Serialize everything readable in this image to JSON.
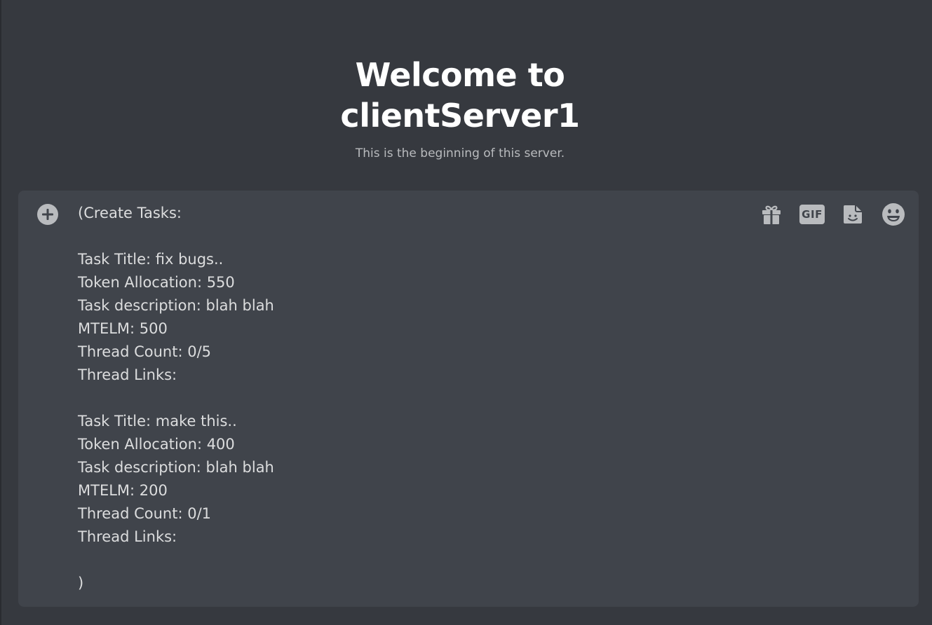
{
  "welcome": {
    "title_line1": "Welcome to",
    "title_line2": "clientServer1",
    "subtitle": "This is the beginning of this server."
  },
  "composer": {
    "message": "(Create Tasks:\n\nTask Title: fix bugs..\nToken Allocation: 550\nTask description: blah blah\nMTELM: 500\nThread Count: 0/5\nThread Links:\n\nTask Title: make this..\nToken Allocation: 400\nTask description: blah blah\nMTELM: 200\nThread Count: 0/1\nThread Links:\n\n)",
    "attach_icon": "plus-circle-icon",
    "toolbar": {
      "gift_icon": "gift-icon",
      "gif_label": "GIF",
      "sticker_icon": "sticker-icon",
      "emoji_icon": "emoji-icon"
    }
  },
  "colors": {
    "background": "#36393f",
    "composer_bg": "#40444b",
    "text": "#dcddde",
    "muted": "#b9bbbe",
    "heading": "#ffffff"
  }
}
